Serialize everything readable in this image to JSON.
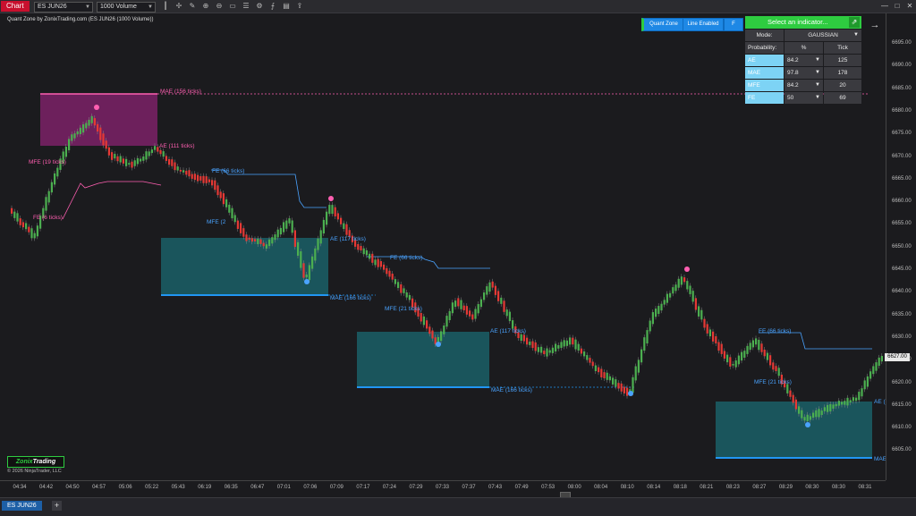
{
  "toolbar": {
    "chart_tab": "Chart",
    "instrument": "ES JUN26",
    "bar_type": "1000 Volume",
    "icons": [
      "bar-style-icon",
      "crosshair-icon",
      "drawing-icon",
      "zoom-in-icon",
      "zoom-out-icon",
      "data-box-icon",
      "properties-icon",
      "strategies-icon",
      "indicators-icon",
      "templates-icon",
      "share-icon"
    ]
  },
  "chart_info": "Quant Zone by ZonixTrading.com (ES JUN26 (1000 Volume))",
  "controls": {
    "quant_zone": "Quant Zone",
    "line_enabled": "Line Enabled",
    "f": "F"
  },
  "panel": {
    "select_label": "Select an indicator...",
    "mode_label": "Mode:",
    "mode_value": "GAUSSIAN",
    "prob_label": "Probability:",
    "pct_header": "%",
    "tick_header": "Tick",
    "rows": [
      {
        "name": "AE",
        "pct": "84.2",
        "tick": "125"
      },
      {
        "name": "MAE",
        "pct": "97.8",
        "tick": "178"
      },
      {
        "name": "MFE",
        "pct": "84.2",
        "tick": "20"
      },
      {
        "name": "FE",
        "pct": "50",
        "tick": "69"
      }
    ]
  },
  "y_ticks": [
    "6695.00",
    "6690.00",
    "6685.00",
    "6680.00",
    "6675.00",
    "6670.00",
    "6665.00",
    "6660.00",
    "6655.00",
    "6650.00",
    "6645.00",
    "6640.00",
    "6635.00",
    "6630.00",
    "6625.00",
    "6620.00",
    "6615.00",
    "6610.00",
    "6605.00"
  ],
  "last_price": "6627.00",
  "x_ticks": [
    "04:34",
    "04:42",
    "04:50",
    "04:57",
    "05:06",
    "05:22",
    "05:43",
    "06:19",
    "06:35",
    "06:47",
    "07:01",
    "07:06",
    "07:09",
    "07:17",
    "07:24",
    "07:29",
    "07:33",
    "07:37",
    "07:43",
    "07:49",
    "07:53",
    "08:00",
    "08:04",
    "08:10",
    "08:14",
    "08:18",
    "08:21",
    "08:23",
    "08:27",
    "08:29",
    "08:30",
    "08:30",
    "08:31"
  ],
  "annotations": {
    "mae_156": "MAE (156 ticks)",
    "ae_111": "AE (111 ticks)",
    "mfe_19": "MFE (19 ticks)",
    "fe_1": "FE (6 ticks)",
    "fe_66_a": "FE (66 ticks)",
    "mfe_2": "MFE (2",
    "ae_117_a": "AE (117 ticks)",
    "mae_166_a": "MAE (166 ticks)",
    "fe_66_b": "FE (66 ticks)",
    "mfe_3": "MFE (21 ticks)",
    "ae_117_b": "AE (117 ticks)",
    "mae_166_b": "MAE (166 ticks)",
    "fe_66_c": "FE (66 ticks)",
    "mfe_4": "MFE (21 ticks)",
    "ae_cut": "AE (",
    "mae_cut": "MAE"
  },
  "logo": {
    "part1": "Zonix",
    "part2": "Trading"
  },
  "copyright": "© 2026 NinjaTrader, LLC",
  "bottom_tab": "ES JUN26",
  "colors": {
    "up": "#4caf50",
    "down": "#e53935",
    "pink": "#ff5fb1",
    "blue": "#4aa3ff",
    "panel_green": "#2ecc40",
    "panel_cyan": "#7dd3f5"
  }
}
